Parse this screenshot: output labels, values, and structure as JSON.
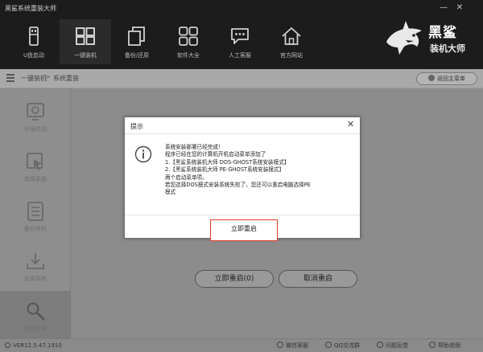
{
  "window": {
    "title": "黑鲨系统重装大师",
    "minimize_glyph": "—",
    "close_glyph": "✕"
  },
  "nav": {
    "items": [
      {
        "label": "U盘启动",
        "icon": "usb-drive-icon",
        "active": false
      },
      {
        "label": "一键装机",
        "icon": "window-grid-icon",
        "active": true
      },
      {
        "label": "备份/还原",
        "icon": "copy-files-icon",
        "active": false
      },
      {
        "label": "软件大全",
        "icon": "apps-grid-icon",
        "active": false
      },
      {
        "label": "人工客服",
        "icon": "chat-bubble-icon",
        "active": false
      },
      {
        "label": "官方网站",
        "icon": "home-icon",
        "active": false
      }
    ]
  },
  "logo": {
    "line1": "黑鲨",
    "line2": "装机大师",
    "icon": "shark-logo-icon"
  },
  "breadcrumb": {
    "home": "一键装机",
    "sep": ">",
    "current": "系统重装",
    "right_button": "返回主菜单"
  },
  "sidebar": {
    "items": [
      {
        "label": "环境检测",
        "icon": "monitor-check-icon",
        "active": false
      },
      {
        "label": "选择系统",
        "icon": "cursor-select-icon",
        "active": false
      },
      {
        "label": "备份资料",
        "icon": "list-file-icon",
        "active": false
      },
      {
        "label": "安装系统",
        "icon": "download-install-icon",
        "active": false
      },
      {
        "label": "重启安装",
        "icon": "wrench-search-icon",
        "active": true
      }
    ]
  },
  "main": {
    "restart_now": "立即重启(0)",
    "cancel_restart": "取消重启"
  },
  "footer": {
    "version": "VER12.5.47.1910",
    "links": [
      "微信客服",
      "QQ交流群",
      "问题反馈",
      "帮助视频"
    ]
  },
  "dialog": {
    "title": "提示",
    "close_glyph": "✕",
    "lines": [
      "系统安装部署已经完成！",
      "程序已经在您的计算机开机启动菜单添加了",
      "1.【黑鲨系统装机大师 DOS-GHOST系统安装模式】",
      "2.【黑鲨系统装机大师 PE-GHOST系统安装模式】",
      "两个启动菜单项。",
      "若您选择DOS模式安装系统失败了，您还可以重启电脑选择PE",
      "模式"
    ],
    "confirm": "立即重启",
    "highlight_color": "#e03a2a"
  }
}
